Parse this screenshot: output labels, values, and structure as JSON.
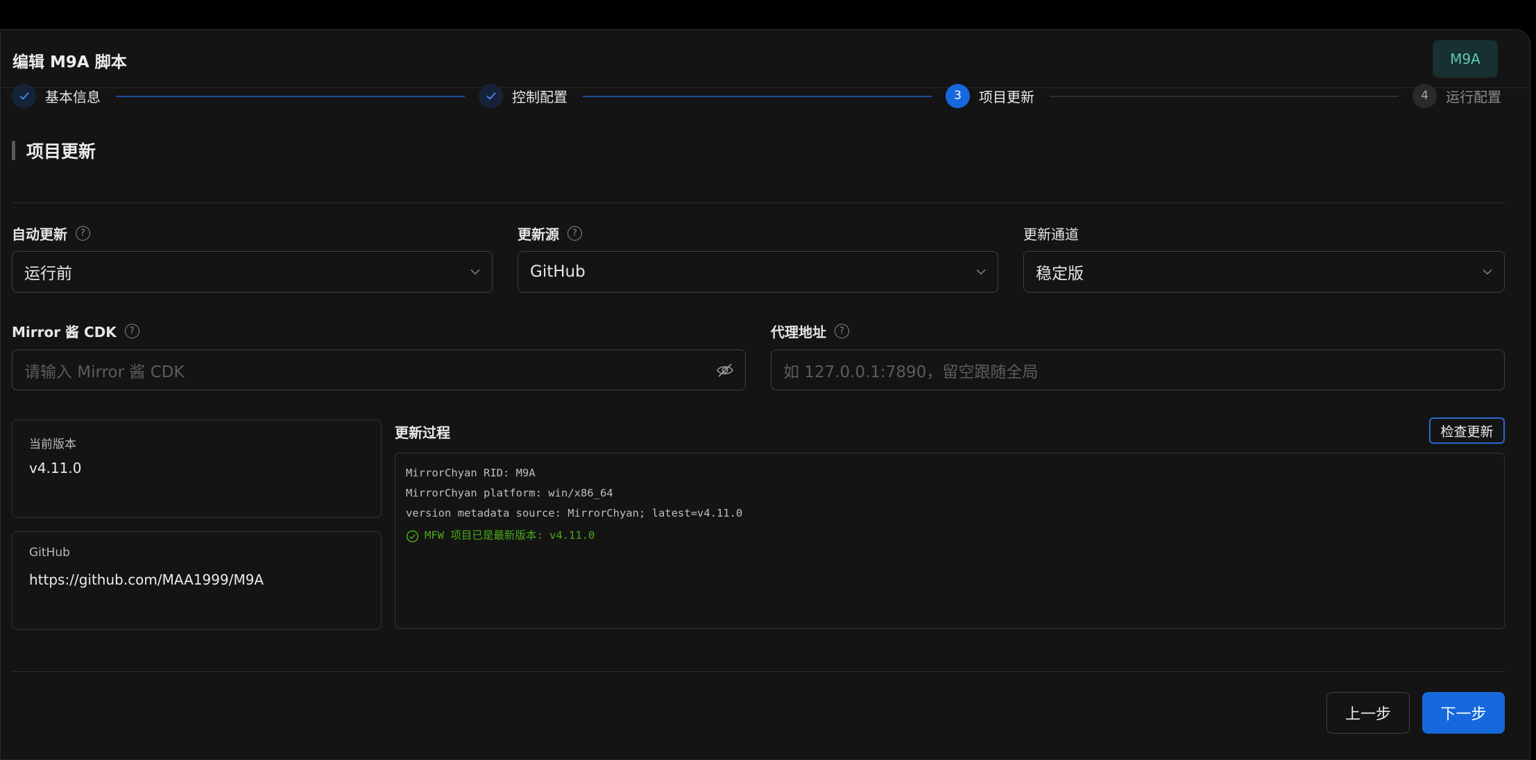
{
  "dialog": {
    "title": "编辑 M9A 脚本",
    "badge": "M9A"
  },
  "steps": [
    {
      "label": "基本信息",
      "status": "done",
      "icon": "check-icon"
    },
    {
      "label": "控制配置",
      "status": "done",
      "icon": "check-icon"
    },
    {
      "label": "项目更新",
      "status": "active",
      "number": "3"
    },
    {
      "label": "运行配置",
      "status": "pending",
      "number": "4"
    }
  ],
  "section": {
    "title": "项目更新"
  },
  "fields": {
    "auto_update": {
      "label": "自动更新",
      "value": "运行前"
    },
    "update_source": {
      "label": "更新源",
      "value": "GitHub"
    },
    "update_channel": {
      "label": "更新通道",
      "value": "稳定版"
    },
    "mirror_cdk": {
      "label": "Mirror 酱 CDK",
      "placeholder": "请输入 Mirror 酱 CDK"
    },
    "proxy": {
      "label": "代理地址",
      "placeholder": "如 127.0.0.1:7890，留空跟随全局"
    }
  },
  "info": {
    "current_version_label": "当前版本",
    "current_version": "v4.11.0",
    "repo_label": "GitHub",
    "repo_url": "https://github.com/MAA1999/M9A"
  },
  "log": {
    "title": "更新过程",
    "check_button": "检查更新",
    "lines": [
      "MirrorChyan RID: M9A",
      "MirrorChyan platform: win/x86_64",
      "version metadata source: MirrorChyan; latest=v4.11.0"
    ],
    "result": "MFW 项目已是最新版本: v4.11.0",
    "result_color": "#49aa19"
  },
  "footer": {
    "prev": "上一步",
    "next": "下一步"
  },
  "colors": {
    "accent": "#1668dc",
    "badge_text": "#5fcab9",
    "background": "#141414"
  }
}
